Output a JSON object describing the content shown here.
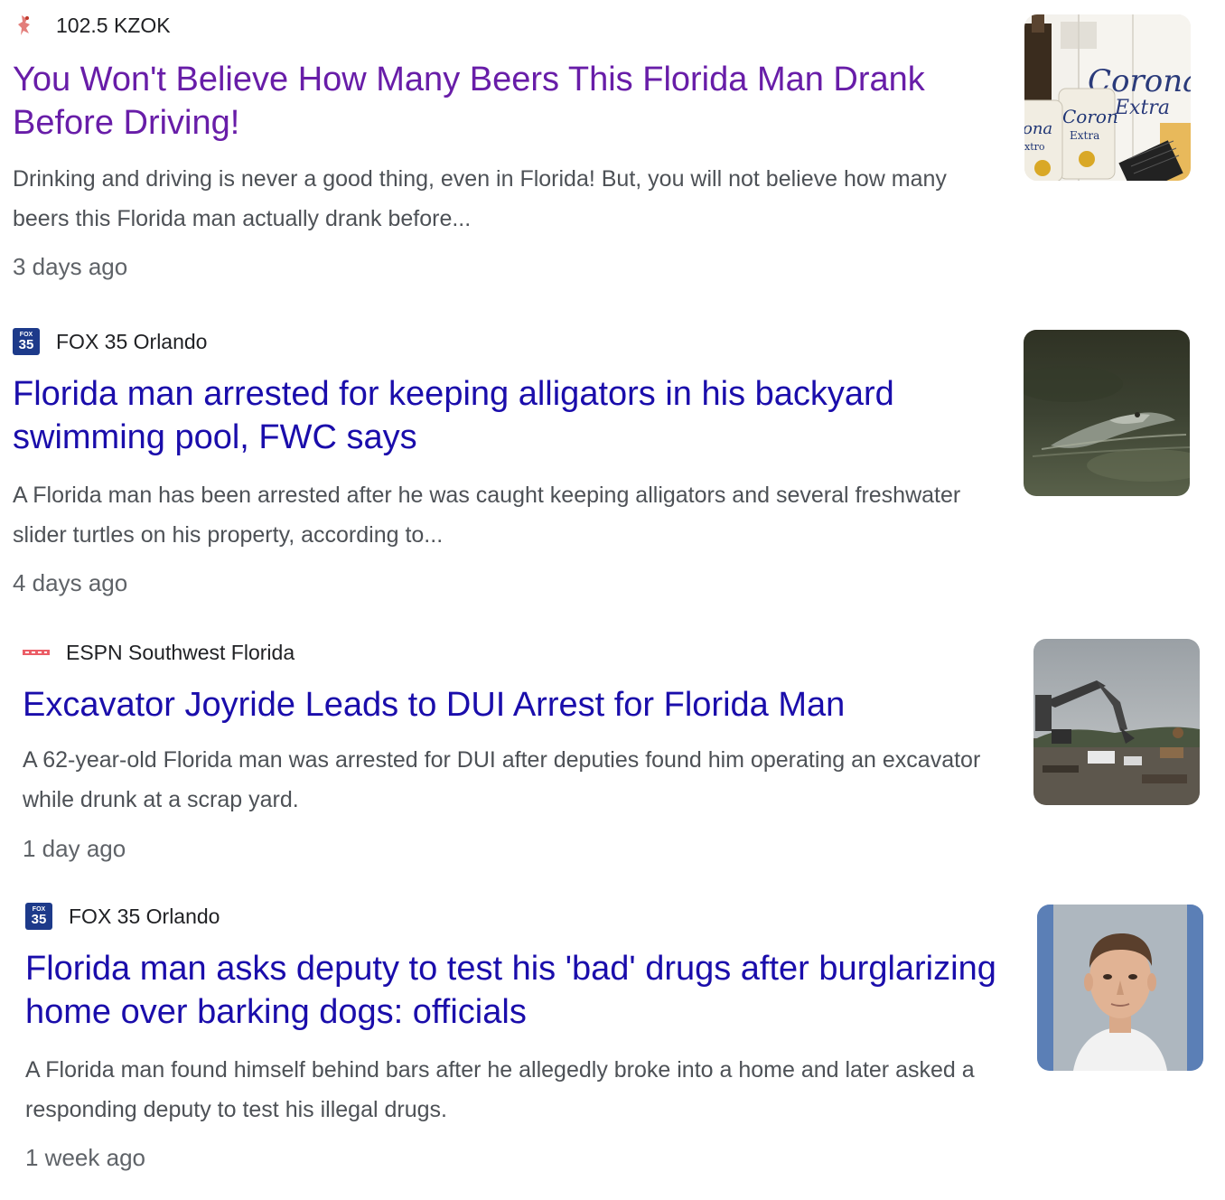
{
  "colors": {
    "link": "#1a0dab",
    "visited_link": "#681da8",
    "snippet": "#4d5156",
    "meta": "#5f6368",
    "fox_logo_bg": "#1d3a8a"
  },
  "results": [
    {
      "source": "102.5 KZOK",
      "logo_icon": "kzok-logo-icon",
      "title": "You Won't Believe How Many Beers This Florida Man Drank Before Driving!",
      "snippet": "Drinking and driving is never a good thing, even in Florida! But, you will not believe how many beers this Florida man actually drank before...",
      "age": "3 days ago",
      "visited": true,
      "thumbnail": "corona-beer-thumbnail"
    },
    {
      "source": "FOX 35 Orlando",
      "logo_icon": "fox35-logo-icon",
      "logo_text_small": "FOX",
      "logo_text_num": "35",
      "title": "Florida man arrested for keeping alligators in his backyard swimming pool, FWC says",
      "snippet": "A Florida man has been arrested after he was caught keeping alligators and several freshwater slider turtles on his property, according to...",
      "age": "4 days ago",
      "visited": false,
      "thumbnail": "alligator-thumbnail"
    },
    {
      "source": "ESPN Southwest Florida",
      "logo_icon": "espn-logo-icon",
      "title": "Excavator Joyride Leads to DUI Arrest for Florida Man",
      "snippet": "A 62-year-old Florida man was arrested for DUI after deputies found him operating an excavator while drunk at a scrap yard.",
      "age": "1 day ago",
      "visited": false,
      "thumbnail": "excavator-thumbnail"
    },
    {
      "source": "FOX 35 Orlando",
      "logo_icon": "fox35-logo-icon",
      "logo_text_small": "FOX",
      "logo_text_num": "35",
      "title": "Florida man asks deputy to test his 'bad' drugs after burglarizing home over barking dogs: officials",
      "snippet": "A Florida man found himself behind bars after he allegedly broke into a home and later asked a responding deputy to test his illegal drugs.",
      "age": "1 week ago",
      "visited": false,
      "thumbnail": "mugshot-thumbnail"
    }
  ]
}
